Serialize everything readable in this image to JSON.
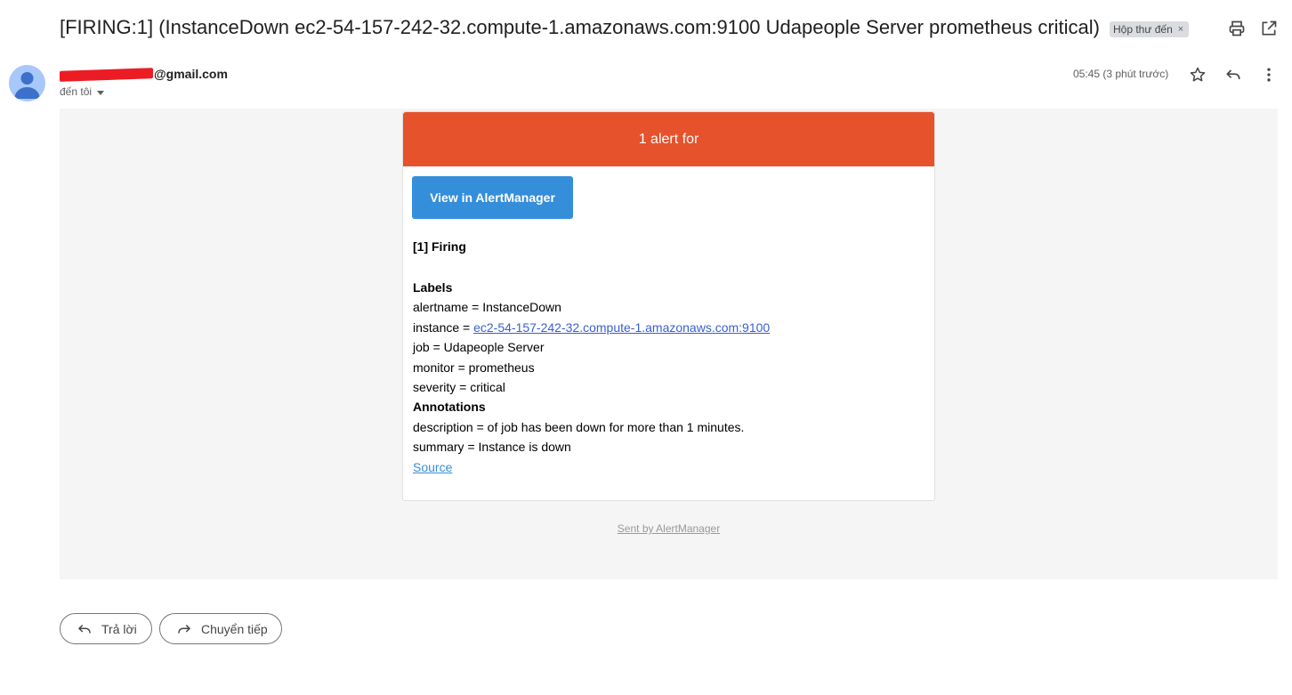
{
  "subject": "[FIRING:1] (InstanceDown ec2-54-157-242-32.compute-1.amazonaws.com:9100 Udapeople Server prometheus critical)",
  "inbox_label": "Hộp thư đến",
  "inbox_label_close": "×",
  "sender": {
    "email_suffix": "@gmail.com",
    "to": "đến tôi"
  },
  "timestamp": "05:45 (3 phút trước)",
  "alert": {
    "header": "1 alert for",
    "view_button": "View in AlertManager",
    "firing": "[1] Firing",
    "labels_title": "Labels",
    "alertname": "alertname = InstanceDown",
    "instance_prefix": "instance = ",
    "instance_link": "ec2-54-157-242-32.compute-1.amazonaws.com:9100",
    "job": "job = Udapeople Server",
    "monitor": "monitor = prometheus",
    "severity": "severity = critical",
    "annotations_title": "Annotations",
    "description": "description = of job has been down for more than 1 minutes.",
    "summary": "summary = Instance is down",
    "source": "Source"
  },
  "sent_by": "Sent by AlertManager",
  "actions": {
    "reply": "Trả lời",
    "forward": "Chuyển tiếp"
  },
  "colors": {
    "alert_header": "#e6522c",
    "button": "#348eda",
    "body_bg": "#f5f5f5"
  }
}
